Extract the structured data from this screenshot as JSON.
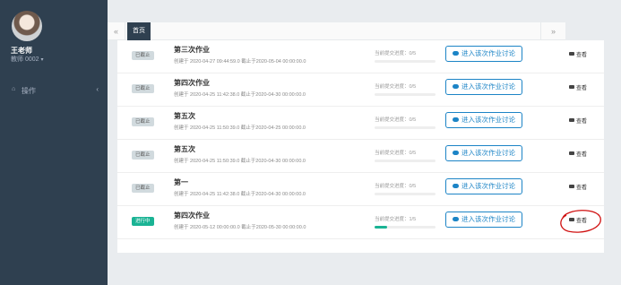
{
  "sidebar": {
    "user_name": "王老师",
    "user_sub": "教师 0002",
    "nav": [
      {
        "label": "操作",
        "icon": "home-icon"
      }
    ]
  },
  "tabs": {
    "prev_icon": "double-chevron-left-icon",
    "active_label": "首页",
    "next_icon": "double-chevron-right-icon"
  },
  "colors": {
    "sidebar_bg": "#2f4050",
    "accent_green": "#1ab394",
    "accent_blue": "#1c84c6",
    "annotation_red": "#d01010"
  },
  "rows": [
    {
      "status": "已截止",
      "active": false,
      "title": "第三次作业",
      "meta": "创建于 2020-04-27 09:44:59.0 截止于2020-05-04 00:00:00.0",
      "progress_label": "当前提交进度：0/5",
      "progress": 0.0,
      "discuss_label": "进入该次作业讨论",
      "view_label": "查看",
      "annotated": false
    },
    {
      "status": "已截止",
      "active": false,
      "title": "第四次作业",
      "meta": "创建于 2020-04-25 11:42:38.0 截止于2020-04-30 00:00:00.0",
      "progress_label": "当前提交进度：0/5",
      "progress": 0.0,
      "discuss_label": "进入该次作业讨论",
      "view_label": "查看",
      "annotated": false
    },
    {
      "status": "已截止",
      "active": false,
      "title": "第五次",
      "meta": "创建于 2020-04-25 11:50:39.0 截止于2020-04-25 00:00:00.0",
      "progress_label": "当前提交进度：0/5",
      "progress": 0.0,
      "discuss_label": "进入该次作业讨论",
      "view_label": "查看",
      "annotated": false
    },
    {
      "status": "已截止",
      "active": false,
      "title": "第五次",
      "meta": "创建于 2020-04-25 11:50:39.0 截止于2020-04-30 00:00:00.0",
      "progress_label": "当前提交进度：0/5",
      "progress": 0.0,
      "discuss_label": "进入该次作业讨论",
      "view_label": "查看",
      "annotated": false
    },
    {
      "status": "已截止",
      "active": false,
      "title": "第一",
      "meta": "创建于 2020-04-25 11:42:38.0 截止于2020-04-30 00:00:00.0",
      "progress_label": "当前提交进度：0/5",
      "progress": 0.0,
      "discuss_label": "进入该次作业讨论",
      "view_label": "查看",
      "annotated": false
    },
    {
      "status": "进行中",
      "active": true,
      "title": "第四次作业",
      "meta": "创建于 2020-05-12 00:00:00.0 截止于2020-05-30 00:00:00.0",
      "progress_label": "当前提交进度：1/5",
      "progress": 0.2,
      "discuss_label": "进入该次作业讨论",
      "view_label": "查看",
      "annotated": true
    }
  ]
}
